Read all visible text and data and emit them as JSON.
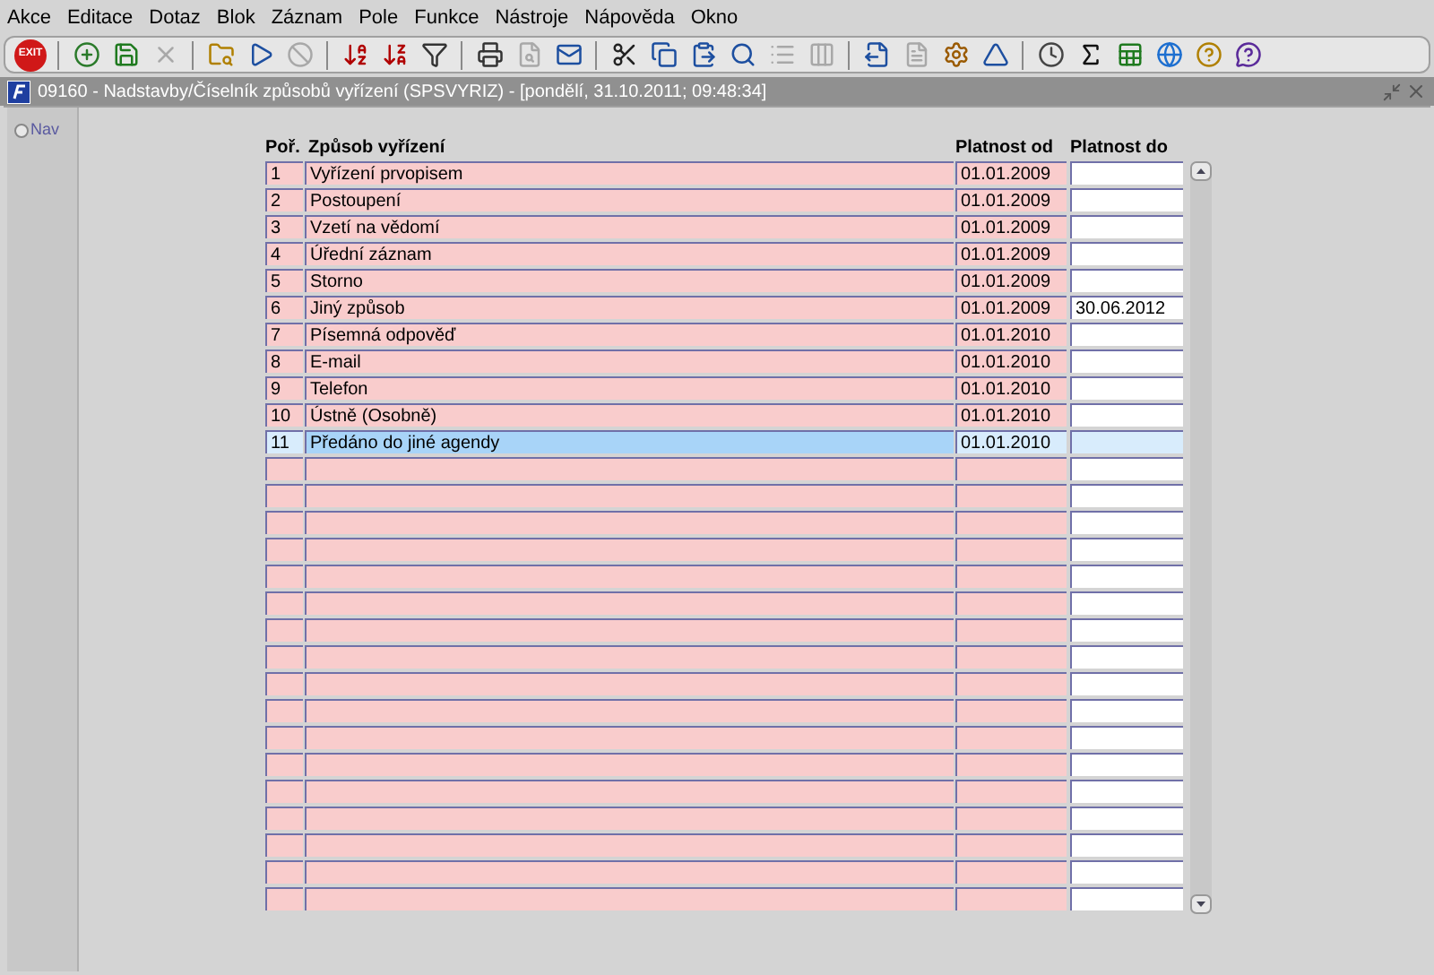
{
  "menu": [
    "Akce",
    "Editace",
    "Dotaz",
    "Blok",
    "Záznam",
    "Pole",
    "Funkce",
    "Nástroje",
    "Nápověda",
    "Okno"
  ],
  "toolbar": [
    {
      "kind": "exit",
      "label": "EXIT",
      "disabled": false
    },
    {
      "kind": "sep"
    },
    {
      "kind": "insert",
      "disabled": false
    },
    {
      "kind": "save",
      "disabled": false
    },
    {
      "kind": "delete",
      "disabled": true
    },
    {
      "kind": "sep"
    },
    {
      "kind": "query",
      "disabled": false
    },
    {
      "kind": "execute",
      "disabled": false
    },
    {
      "kind": "cancel",
      "disabled": true
    },
    {
      "kind": "sep"
    },
    {
      "kind": "sortasc",
      "disabled": false
    },
    {
      "kind": "sortdesc",
      "disabled": false
    },
    {
      "kind": "filter",
      "disabled": false
    },
    {
      "kind": "sep"
    },
    {
      "kind": "print",
      "disabled": false
    },
    {
      "kind": "preview",
      "disabled": true
    },
    {
      "kind": "mail",
      "disabled": false
    },
    {
      "kind": "sep"
    },
    {
      "kind": "cut",
      "disabled": false
    },
    {
      "kind": "copy",
      "disabled": false
    },
    {
      "kind": "paste",
      "disabled": false
    },
    {
      "kind": "search",
      "disabled": false
    },
    {
      "kind": "list",
      "disabled": true
    },
    {
      "kind": "columns",
      "disabled": true
    },
    {
      "kind": "sep"
    },
    {
      "kind": "export",
      "disabled": false
    },
    {
      "kind": "document",
      "disabled": true
    },
    {
      "kind": "wheel",
      "disabled": false
    },
    {
      "kind": "triangle",
      "disabled": false
    },
    {
      "kind": "sep"
    },
    {
      "kind": "clock",
      "disabled": false
    },
    {
      "kind": "sigma",
      "disabled": false
    },
    {
      "kind": "excel",
      "disabled": false
    },
    {
      "kind": "browser",
      "disabled": false
    },
    {
      "kind": "help",
      "disabled": false
    },
    {
      "kind": "helpwin",
      "disabled": false
    }
  ],
  "window": {
    "title": "09160 - Nadstavby/Číselník způsobů vyřízení (SPSVYRIZ) - [pondělí, 31.10.2011; 09:48:34]",
    "active": false
  },
  "nav": {
    "label": "Nav",
    "selected": false
  },
  "table": {
    "columns": [
      "Poř.",
      "Způsob vyřízení",
      "Platnost od",
      "Platnost do"
    ],
    "rows": [
      {
        "cells": [
          "1",
          "Vyřízení prvopisem",
          "01.01.2009",
          ""
        ],
        "selected": false
      },
      {
        "cells": [
          "2",
          "Postoupení",
          "01.01.2009",
          ""
        ],
        "selected": false
      },
      {
        "cells": [
          "3",
          "Vzetí na vědomí",
          "01.01.2009",
          ""
        ],
        "selected": false
      },
      {
        "cells": [
          "4",
          "Úřední záznam",
          "01.01.2009",
          ""
        ],
        "selected": false
      },
      {
        "cells": [
          "5",
          "Storno",
          "01.01.2009",
          ""
        ],
        "selected": false
      },
      {
        "cells": [
          "6",
          "Jiný způsob",
          "01.01.2009",
          "30.06.2012"
        ],
        "selected": false
      },
      {
        "cells": [
          "7",
          "Písemná odpověď",
          "01.01.2010",
          ""
        ],
        "selected": false
      },
      {
        "cells": [
          "8",
          "E-mail",
          "01.01.2010",
          ""
        ],
        "selected": false
      },
      {
        "cells": [
          "9",
          "Telefon",
          "01.01.2010",
          ""
        ],
        "selected": false
      },
      {
        "cells": [
          "10",
          "Ústně (Osobně)",
          "01.01.2010",
          ""
        ],
        "selected": false
      },
      {
        "cells": [
          "11",
          "Předáno do jiné agendy",
          "01.01.2010",
          ""
        ],
        "selected": true
      }
    ]
  }
}
